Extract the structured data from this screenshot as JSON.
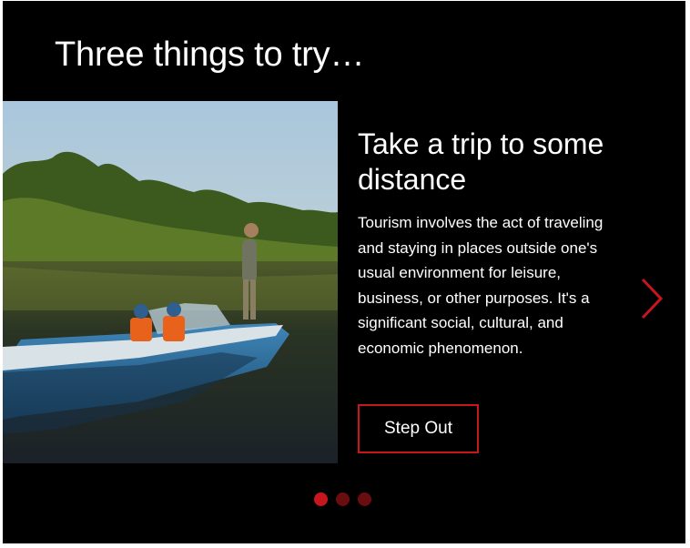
{
  "carousel": {
    "heading": "Three things to try…",
    "slide": {
      "title": "Take a trip to some distance",
      "body": "Tourism involves the act of traveling and staying in places outside one's usual environment for leisure, business, or other purposes. It's a significant social, cultural, and economic phenomenon.",
      "cta_label": "Step Out",
      "image": {
        "subject": "photo-man-standing-on-motorboat-with-children-in-life-vests-on-river"
      }
    },
    "next_arrow_icon": "chevron-right-icon",
    "pagination": {
      "total": 3,
      "active_index": 0
    }
  },
  "colors": {
    "background": "#000000",
    "accent": "#c8161d",
    "dot_active": "#c8161d",
    "dot_inactive": "#6a0d0f",
    "text": "#ffffff"
  }
}
